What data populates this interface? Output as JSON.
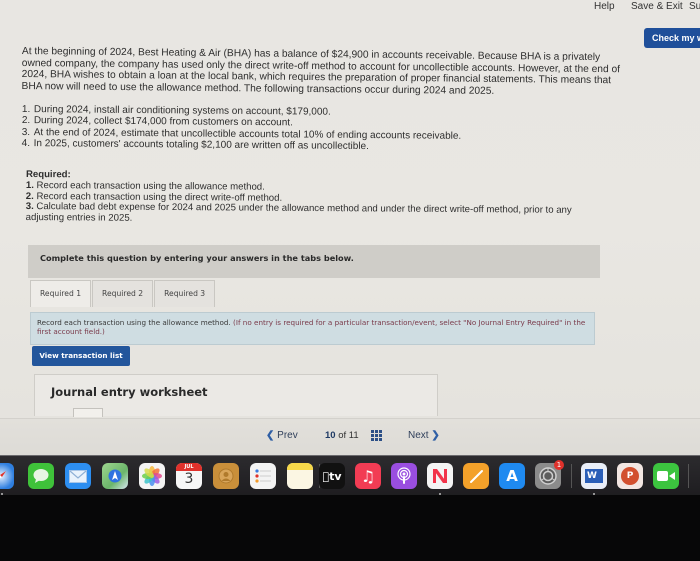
{
  "topbar": {
    "help_label": "Help",
    "save_exit_label": "Save & Exit",
    "submit_label_partial": "Su",
    "check_my_work_label": "Check my w"
  },
  "problem": {
    "intro": "At the beginning of 2024, Best Heating & Air (BHA) has a balance of $24,900 in accounts receivable. Because BHA is a privately owned company, the company has used only the direct write-off method to account for uncollectible accounts. However, at the end of 2024, BHA wishes to obtain a loan at the local bank, which requires the preparation of proper financial statements. This means that BHA now will need to use the allowance method. The following transactions occur during 2024 and 2025.",
    "transactions": [
      {
        "num": "1.",
        "text": "During 2024, install air conditioning systems on account, $179,000."
      },
      {
        "num": "2.",
        "text": "During 2024, collect $174,000 from customers on account."
      },
      {
        "num": "3.",
        "text": "At the end of 2024, estimate that uncollectible accounts total 10% of ending accounts receivable."
      },
      {
        "num": "4.",
        "text": "In 2025, customers' accounts totaling $2,100 are written off as uncollectible."
      }
    ]
  },
  "required": {
    "heading": "Required:",
    "items": [
      {
        "num": "1.",
        "text": "Record each transaction using the allowance method."
      },
      {
        "num": "2.",
        "text": "Record each transaction using the direct write-off method."
      },
      {
        "num": "3.",
        "text": "Calculate bad debt expense for 2024 and 2025 under the allowance method and under the direct write-off method, prior to any adjusting entries in 2025."
      }
    ]
  },
  "complete_banner": "Complete this question by entering your answers in the tabs below.",
  "tabs": [
    {
      "label": "Required 1",
      "active": true
    },
    {
      "label": "Required 2",
      "active": false
    },
    {
      "label": "Required 3",
      "active": false
    }
  ],
  "instructions": {
    "main": "Record each transaction using the allowance method.",
    "hint": "(If no entry is required for a particular transaction/event, select \"No Journal Entry Required\" in the first account field.)"
  },
  "view_transaction_list_label": "View transaction list",
  "worksheet": {
    "title": "Journal entry worksheet"
  },
  "pagination": {
    "prev_label": "Prev",
    "current": "10",
    "of_label": "of",
    "total": "11",
    "next_label": "Next",
    "prev_icon": "chevron-left-icon",
    "next_icon": "chevron-right-icon",
    "grid_icon": "grid-icon"
  },
  "dock": {
    "apps": [
      {
        "name": "Safari",
        "icon": "safari-icon",
        "color": "#2f7fe0"
      },
      {
        "name": "Messages",
        "icon": "messages-icon",
        "color": "#3fc23a"
      },
      {
        "name": "Mail",
        "icon": "mail-icon",
        "color": "#2d8ef0"
      },
      {
        "name": "Maps",
        "icon": "maps-icon",
        "color": "#6bb56a"
      },
      {
        "name": "Photos",
        "icon": "photos-icon",
        "color": "#f4f4f4"
      },
      {
        "name": "Calendar",
        "icon": "calendar-icon",
        "color": "#f7f7f7",
        "month": "JUL",
        "day": "3"
      },
      {
        "name": "Contacts",
        "icon": "contacts-icon",
        "color": "#c98f3a"
      },
      {
        "name": "Reminders",
        "icon": "reminders-icon",
        "color": "#f3f3f3"
      },
      {
        "name": "Notes",
        "icon": "notes-icon",
        "color": "#f6e79a"
      },
      {
        "name": "TV",
        "icon": "tv-icon",
        "color": "#111111",
        "label": "tv"
      },
      {
        "name": "Music",
        "icon": "music-icon",
        "color": "#f23c54"
      },
      {
        "name": "Podcasts",
        "icon": "podcasts-icon",
        "color": "#9a4ee0"
      },
      {
        "name": "News",
        "icon": "news-icon",
        "color": "#f4f4f4"
      },
      {
        "name": "Pages",
        "icon": "pages-icon",
        "color": "#f3a12a"
      },
      {
        "name": "App Store",
        "icon": "app-store-icon",
        "color": "#1f8af0"
      },
      {
        "name": "System Settings",
        "icon": "settings-icon",
        "color": "#8b8b8b",
        "badge": "1"
      },
      {
        "name": "Word",
        "icon": "word-icon",
        "color": "#e9eef8",
        "letter": "W"
      },
      {
        "name": "PowerPoint",
        "icon": "powerpoint-icon",
        "color": "#f2e6e2",
        "letter": "P"
      },
      {
        "name": "FaceTime",
        "icon": "facetime-icon",
        "color": "#3cc43f"
      }
    ]
  }
}
